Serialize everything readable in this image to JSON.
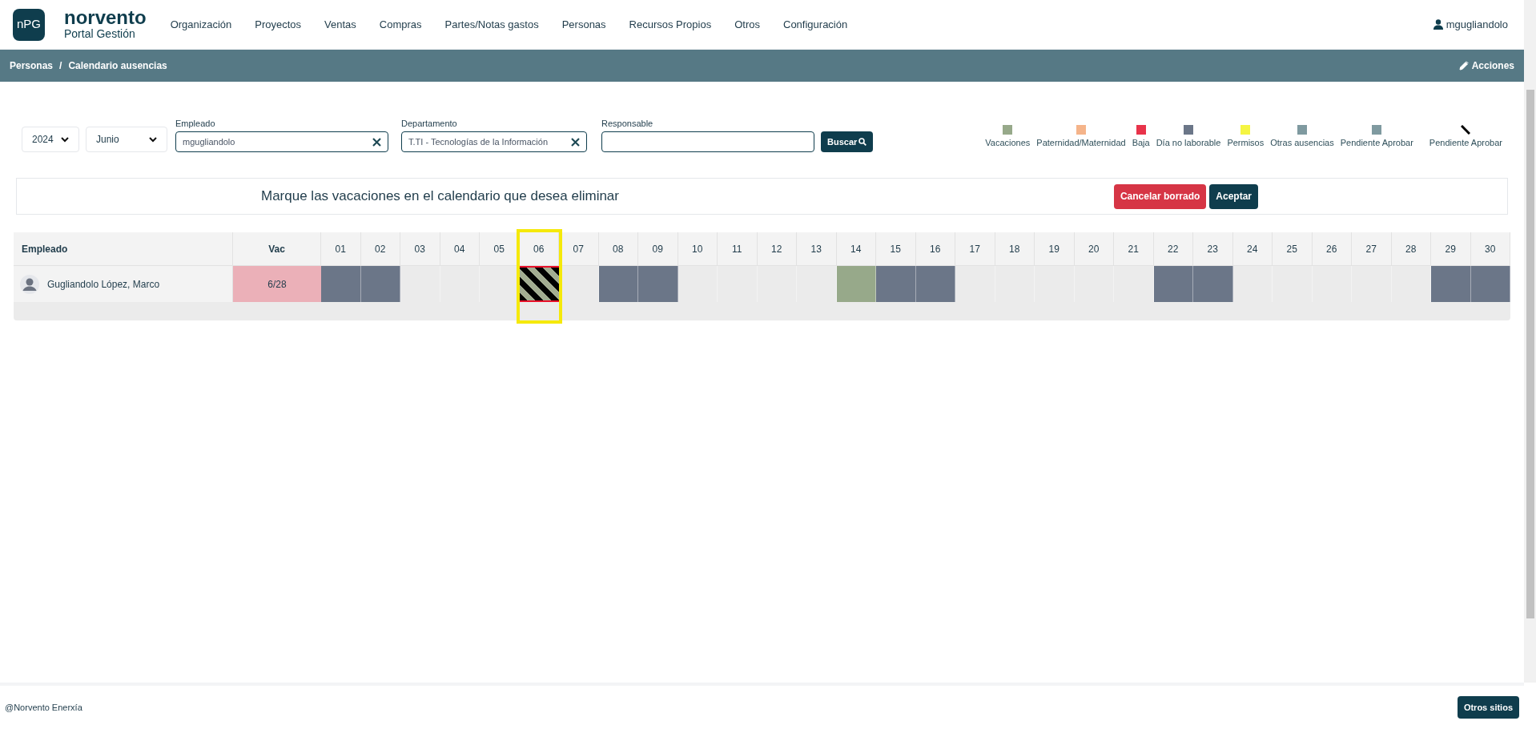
{
  "header": {
    "logo_badge": "nPG",
    "brand": "norvento",
    "subtitle": "Portal Gestión",
    "nav": [
      "Organización",
      "Proyectos",
      "Ventas",
      "Compras",
      "Partes/Notas gastos",
      "Personas",
      "Recursos Propios",
      "Otros",
      "Configuración"
    ],
    "user": "mgugliandolo"
  },
  "breadcrumb": {
    "items": [
      "Personas",
      "Calendario ausencias"
    ],
    "separator": "/",
    "action": "Acciones"
  },
  "filters": {
    "year": "2024",
    "month": "Junio",
    "employee": {
      "label": "Empleado",
      "value": "mgugliandolo"
    },
    "department": {
      "label": "Departamento",
      "value": "T.TI - Tecnologías de la Información"
    },
    "manager": {
      "label": "Responsable"
    },
    "search_button": "Buscar"
  },
  "legend": [
    {
      "label": "Vacaciones",
      "kind": "swatch",
      "color": "#97a98a"
    },
    {
      "label": "Paternidad/Maternidad",
      "kind": "swatch",
      "color": "#f5b48a"
    },
    {
      "label": "Baja",
      "kind": "swatch",
      "color": "#e8334a"
    },
    {
      "label": "Día no laborable",
      "kind": "swatch",
      "color": "#6b7688"
    },
    {
      "label": "Permisos",
      "kind": "swatch",
      "color": "#f5f542"
    },
    {
      "label": "Otras ausencias",
      "kind": "swatch",
      "color": "#7f9aa0"
    },
    {
      "label": "Pendiente Aprobar",
      "kind": "swatch",
      "color": "#7f9aa0"
    },
    {
      "label": "Pendiente Aprobar",
      "kind": "stripe"
    }
  ],
  "notice": {
    "message": "Marque las vacaciones en el calendario que desea eliminar",
    "cancel_button": "Cancelar borrado",
    "accept_button": "Aceptar"
  },
  "table": {
    "employee_header": "Empleado",
    "vac_header": "Vac",
    "days": [
      {
        "label": "01",
        "selected": false
      },
      {
        "label": "02",
        "selected": false
      },
      {
        "label": "03",
        "selected": false
      },
      {
        "label": "04",
        "selected": false
      },
      {
        "label": "05",
        "selected": false
      },
      {
        "label": "06",
        "selected": true
      },
      {
        "label": "07",
        "selected": false
      },
      {
        "label": "08",
        "selected": false
      },
      {
        "label": "09",
        "selected": false
      },
      {
        "label": "10",
        "selected": false
      },
      {
        "label": "11",
        "selected": false
      },
      {
        "label": "12",
        "selected": false
      },
      {
        "label": "13",
        "selected": false
      },
      {
        "label": "14",
        "selected": false
      },
      {
        "label": "15",
        "selected": false
      },
      {
        "label": "16",
        "selected": false
      },
      {
        "label": "17",
        "selected": false
      },
      {
        "label": "18",
        "selected": false
      },
      {
        "label": "19",
        "selected": false
      },
      {
        "label": "20",
        "selected": false
      },
      {
        "label": "21",
        "selected": false
      },
      {
        "label": "22",
        "selected": false
      },
      {
        "label": "23",
        "selected": false
      },
      {
        "label": "24",
        "selected": false
      },
      {
        "label": "25",
        "selected": false
      },
      {
        "label": "26",
        "selected": false
      },
      {
        "label": "27",
        "selected": false
      },
      {
        "label": "28",
        "selected": false
      },
      {
        "label": "29",
        "selected": false
      },
      {
        "label": "30",
        "selected": false
      }
    ],
    "rows": [
      {
        "name": "Gugliandolo López, Marco",
        "vac": "6/28",
        "cells": [
          {
            "kind": "nonworking"
          },
          {
            "kind": "nonworking"
          },
          {
            "kind": "empty"
          },
          {
            "kind": "empty"
          },
          {
            "kind": "empty"
          },
          {
            "kind": "pending"
          },
          {
            "kind": "empty"
          },
          {
            "kind": "nonworking"
          },
          {
            "kind": "nonworking"
          },
          {
            "kind": "empty"
          },
          {
            "kind": "empty"
          },
          {
            "kind": "empty"
          },
          {
            "kind": "empty"
          },
          {
            "kind": "vacation"
          },
          {
            "kind": "nonworking"
          },
          {
            "kind": "nonworking"
          },
          {
            "kind": "empty"
          },
          {
            "kind": "empty"
          },
          {
            "kind": "empty"
          },
          {
            "kind": "empty"
          },
          {
            "kind": "empty"
          },
          {
            "kind": "nonworking"
          },
          {
            "kind": "nonworking"
          },
          {
            "kind": "empty"
          },
          {
            "kind": "empty"
          },
          {
            "kind": "empty"
          },
          {
            "kind": "empty"
          },
          {
            "kind": "empty"
          },
          {
            "kind": "nonworking"
          },
          {
            "kind": "nonworking"
          }
        ]
      }
    ]
  },
  "footer": {
    "copyright": "@Norvento Enerxía",
    "button": "Otros sitios"
  }
}
